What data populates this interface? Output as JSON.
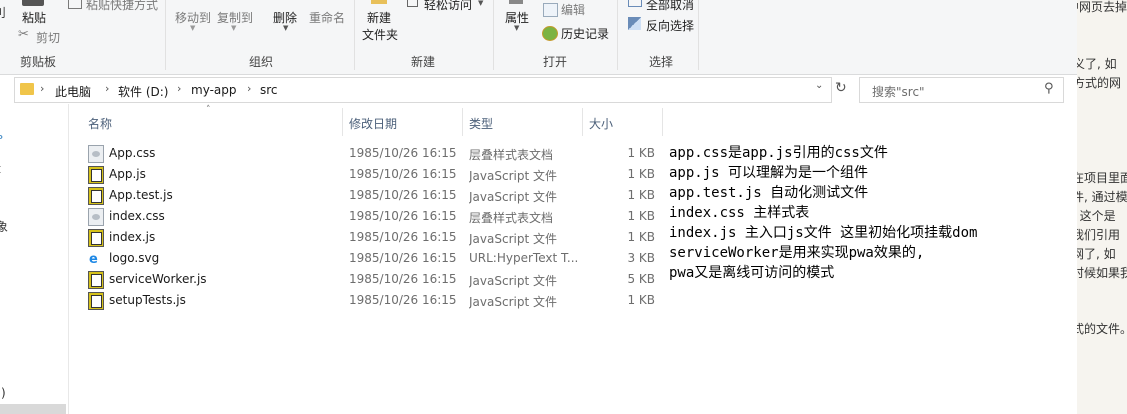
{
  "ribbon": {
    "clipboard": {
      "paste": "粘贴",
      "cut": "剪切",
      "paste_shortcut": "粘贴快捷方式",
      "group": "剪贴板"
    },
    "organize": {
      "move_to": "移动到",
      "copy_to": "复制到",
      "delete": "删除",
      "rename": "重命名",
      "group": "组织"
    },
    "new": {
      "new_folder_line1": "新建",
      "new_folder_line2": "文件夹",
      "easy_access": "轻松访问",
      "group": "新建"
    },
    "open": {
      "properties": "属性",
      "edit": "编辑",
      "history": "历史记录",
      "group": "打开"
    },
    "select": {
      "select_none": "全部取消",
      "invert": "反向选择",
      "group": "选择"
    }
  },
  "address": {
    "crumbs": [
      "此电脑",
      "软件 (D:)",
      "my-app",
      "src"
    ],
    "search_placeholder": "搜索\"src\""
  },
  "columns": {
    "name": "名称",
    "date": "修改日期",
    "type": "类型",
    "size": "大小"
  },
  "files": [
    {
      "name": "App.css",
      "date": "1985/10/26 16:15",
      "type": "层叠样式表文档",
      "size": "1 KB",
      "icon": "css-file-icon"
    },
    {
      "name": "App.js",
      "date": "1985/10/26 16:15",
      "type": "JavaScript 文件",
      "size": "1 KB",
      "icon": "js-file-icon"
    },
    {
      "name": "App.test.js",
      "date": "1985/10/26 16:15",
      "type": "JavaScript 文件",
      "size": "1 KB",
      "icon": "js-file-icon"
    },
    {
      "name": "index.css",
      "date": "1985/10/26 16:15",
      "type": "层叠样式表文档",
      "size": "1 KB",
      "icon": "css-file-icon"
    },
    {
      "name": "index.js",
      "date": "1985/10/26 16:15",
      "type": "JavaScript 文件",
      "size": "1 KB",
      "icon": "js-file-icon"
    },
    {
      "name": "logo.svg",
      "date": "1985/10/26 16:15",
      "type": "URL:HyperText T...",
      "size": "3 KB",
      "icon": "ie-file-icon"
    },
    {
      "name": "serviceWorker.js",
      "date": "1985/10/26 16:15",
      "type": "JavaScript 文件",
      "size": "5 KB",
      "icon": "js-file-icon"
    },
    {
      "name": "setupTests.js",
      "date": "1985/10/26 16:15",
      "type": "JavaScript 文件",
      "size": "1 KB",
      "icon": "js-file-icon"
    }
  ],
  "notes": [
    "app.css是app.js引用的css文件",
    "app.js 可以理解为是一个组件",
    "app.test.js 自动化测试文件",
    "index.css 主样式表",
    "index.js 主入口js文件 这里初始化项挂载dom",
    "serviceWorker是用来实现pwa效果的,",
    "pwa又是离线可访问的模式"
  ],
  "left_pane": {
    "items": [
      "刂",
      "ь",
      "t",
      "象",
      ":)"
    ]
  },
  "background_doc": {
    "lines": [
      "中网页去掉",
      "义了, 如",
      "方式的网",
      "在项目里面",
      "件, 通过模",
      ", 这个是",
      "我们引用",
      "网了, 如",
      "时候如果我",
      "式的文件。"
    ]
  },
  "colors": {
    "accent": "#4c607a",
    "js_icon": "#d6c21a"
  }
}
